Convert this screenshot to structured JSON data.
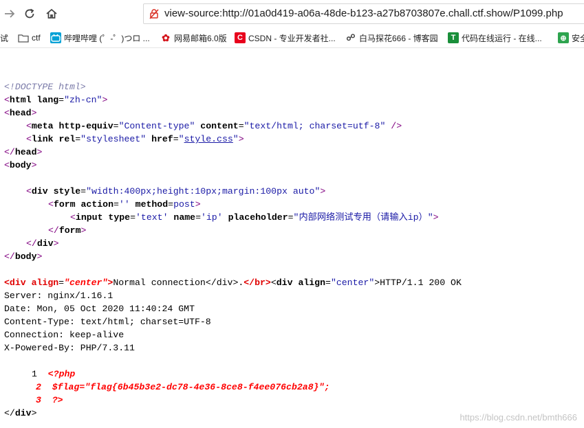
{
  "browser": {
    "url": "view-source:http://01a0d419-a06a-48de-b123-a27b8703807e.chall.ctf.show/P1099.php",
    "icons": [
      "forward-arrow-icon",
      "reload-icon",
      "home-icon",
      "not-secure-icon"
    ]
  },
  "bookmarks": [
    {
      "label": "试",
      "icon": "none"
    },
    {
      "label": "ctf",
      "icon": "folder-icon"
    },
    {
      "label": "哔哩哔哩 (゜-゜)つロ ...",
      "icon": "bilibili-icon"
    },
    {
      "label": "网易邮箱6.0版",
      "icon": "netease-icon"
    },
    {
      "label": "CSDN - 专业开发者社...",
      "icon": "csdn-icon"
    },
    {
      "label": "白马探花666 - 博客园",
      "icon": "cnblogs-icon"
    },
    {
      "label": "代码在线运行 - 在线...",
      "icon": "code-runner-icon"
    },
    {
      "label": "安全",
      "icon": "security-icon"
    }
  ],
  "source": {
    "doctype": "<!DOCTYPE html>",
    "html_open": [
      "<",
      "html",
      " lang",
      "=",
      "\"zh-cn\"",
      ">"
    ],
    "head_open": "head",
    "meta": {
      "http_equiv_val": "\"Content-type\"",
      "content_val": "\"text/html; charset=utf-8\""
    },
    "link": {
      "rel_val": "\"stylesheet\"",
      "href_val": "style.css"
    },
    "head_close": "head",
    "body_open": "body",
    "div_style_val": "\"width:400px;height:10px;margin:100px auto\"",
    "form_action_val": "''",
    "form_method_val": "post",
    "input": {
      "type_val": "'text'",
      "name_val": "'ip'",
      "placeholder_val": "\"内部网络测试专用（请输入ip）\""
    },
    "response_line": "Normal connection",
    "http_status": "HTTP/1.1 200 OK",
    "headers": [
      "Server: nginx/1.16.1",
      "Date: Mon, 05 Oct 2020 11:40:24 GMT",
      "Content-Type: text/html; charset=UTF-8",
      "Connection: keep-alive",
      "X-Powered-By: PHP/7.3.11"
    ],
    "php_lines": [
      {
        "num": "1",
        "code": "<?php"
      },
      {
        "num": "2",
        "code": "$flag=\"flag{6b45b3e2-dc78-4e36-8ce8-f4ee076cb2a8}\";"
      },
      {
        "num": "3",
        "code": "?>"
      }
    ]
  },
  "watermark": "https://blog.csdn.net/bmth666"
}
